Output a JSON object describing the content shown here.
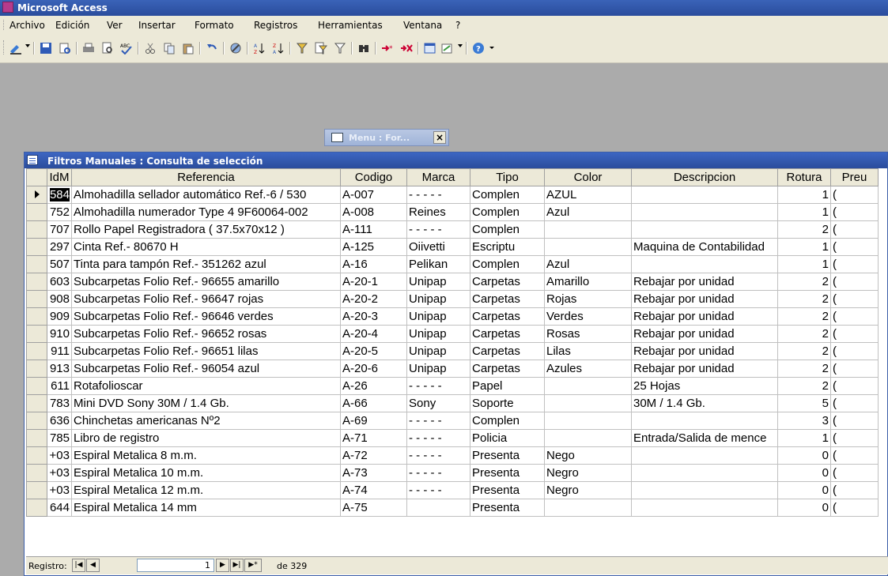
{
  "app": {
    "title": "Microsoft Access"
  },
  "menu": [
    "Archivo",
    "Edición",
    "Ver",
    "Insertar",
    "Formato",
    "Registros",
    "Herramientas",
    "Ventana",
    "?"
  ],
  "toolbar": {
    "icons": [
      "view-icon",
      "save-icon",
      "search-db-icon",
      "print-icon",
      "print-preview-icon",
      "spelling-icon",
      "cut-icon",
      "copy-icon",
      "paste-icon",
      "undo-icon",
      "hyperlink-icon",
      "sort-asc-icon",
      "sort-desc-icon",
      "filter-by-selection-icon",
      "filter-by-form-icon",
      "apply-filter-icon",
      "find-icon",
      "new-record-icon",
      "delete-record-icon",
      "database-window-icon",
      "new-object-icon",
      "help-icon"
    ]
  },
  "menu_window": {
    "title": "Menu : For...",
    "close": "×"
  },
  "query_window": {
    "title": "Filtros Manuales : Consulta de selección",
    "columns": [
      "IdM",
      "Referencia",
      "Codigo",
      "Marca",
      "Tipo",
      "Color",
      "Descripcion",
      "Rotura",
      "Preu"
    ],
    "rows": [
      [
        "584",
        "Almohadilla sellador automático Ref.-6 / 530",
        "A-007",
        "- - - - -",
        "Complen",
        "AZUL",
        "",
        "1",
        "("
      ],
      [
        "752",
        "Almohadilla numerador Type 4 9F60064-002",
        "A-008",
        "Reines",
        "Complen",
        "Azul",
        "",
        "1",
        "("
      ],
      [
        "707",
        "Rollo Papel Registradora  ( 37.5x70x12 )",
        "A-111",
        "- - - - -",
        "Complen",
        "",
        "",
        "2",
        "("
      ],
      [
        "297",
        "Cinta  Ref.-  80670 H",
        "A-125",
        "Oiivetti",
        "Escriptu",
        "",
        "Maquina de  Contabilidad",
        "1",
        "("
      ],
      [
        "507",
        "Tinta para tampón  Ref.- 351262 azul",
        "A-16",
        "Pelikan",
        "Complen",
        "Azul",
        "",
        "1",
        "("
      ],
      [
        "603",
        "Subcarpetas Folio  Ref.- 96655 amarillo",
        "A-20-1",
        "Unipap",
        "Carpetas",
        "Amarillo",
        "Rebajar por unidad",
        "2",
        "("
      ],
      [
        "908",
        "Subcarpetas Folio  Ref.- 96647 rojas",
        "A-20-2",
        "Unipap",
        "Carpetas",
        "Rojas",
        "Rebajar por unidad",
        "2",
        "("
      ],
      [
        "909",
        "Subcarpetas Folio  Ref.- 96646 verdes",
        "A-20-3",
        "Unipap",
        "Carpetas",
        "Verdes",
        "Rebajar por unidad",
        "2",
        "("
      ],
      [
        "910",
        "Subcarpetas Folio  Ref.- 96652 rosas",
        "A-20-4",
        "Unipap",
        "Carpetas",
        "Rosas",
        "Rebajar por unidad",
        "2",
        "("
      ],
      [
        "911",
        "Subcarpetas Folio  Ref.- 96651 lilas",
        "A-20-5",
        "Unipap",
        "Carpetas",
        "Lilas",
        "Rebajar por unidad",
        "2",
        "("
      ],
      [
        "913",
        "Subcarpetas Folio  Ref.- 96054 azul",
        "A-20-6",
        "Unipap",
        "Carpetas",
        "Azules",
        "Rebajar por unidad",
        "2",
        "("
      ],
      [
        "611",
        "Rotafolioscar",
        "A-26",
        "- - - - -",
        "Papel",
        "",
        "25 Hojas",
        "2",
        "("
      ],
      [
        "783",
        "Mini  DVD Sony  30M / 1.4 Gb.",
        "A-66",
        "Sony",
        "Soporte",
        "",
        "30M / 1.4 Gb.",
        "5",
        "("
      ],
      [
        "636",
        "Chinchetas americanas  Nº2",
        "A-69",
        "- - - - -",
        "Complen",
        "",
        "",
        "3",
        "("
      ],
      [
        "785",
        "Libro de registro",
        "A-71",
        "- - - - -",
        "Policia",
        "",
        "Entrada/Salida de mence",
        "1",
        "("
      ],
      [
        "+03",
        "Espiral  Metalica   8 m.m.",
        "A-72",
        "- - - - -",
        "Presenta",
        "Nego",
        "",
        "0",
        "("
      ],
      [
        "+03",
        "Espiral  Metalica  10 m.m.",
        "A-73",
        "- - - - -",
        "Presenta",
        "Negro",
        "",
        "0",
        "("
      ],
      [
        "+03",
        "Espiral  Metalica  12 m.m.",
        "A-74",
        "- - - - -",
        "Presenta",
        "Negro",
        "",
        "0",
        "("
      ],
      [
        "644",
        "Espiral  Metalica  14 mm",
        "A-75",
        "",
        "Presenta",
        "",
        "",
        "0",
        "("
      ]
    ],
    "current_row": 0
  },
  "navigation": {
    "label": "Registro:",
    "current": "1",
    "of_text": "de 329"
  },
  "colors": {
    "titlebar": "#2a4c9c",
    "chrome": "#ece9d8",
    "workspace": "#ababab"
  }
}
